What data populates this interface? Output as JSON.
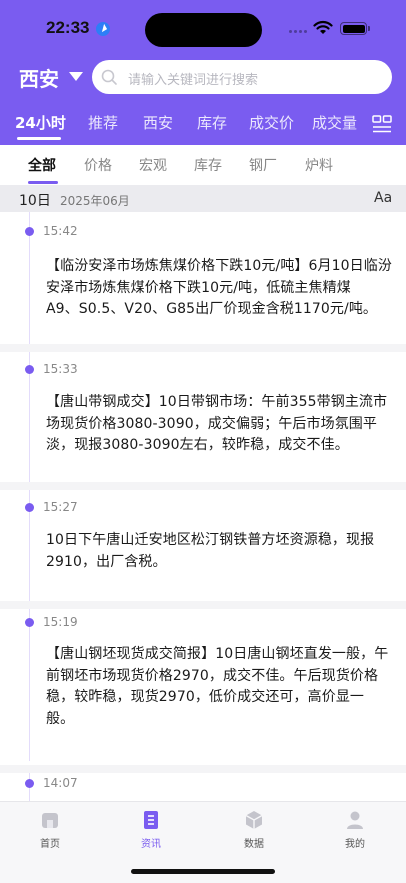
{
  "status_bar": {
    "time": "22:33"
  },
  "header": {
    "city": "西安",
    "search_placeholder": "请输入关键词进行搜索",
    "tabs": [
      "24小时",
      "推荐",
      "西安",
      "库存",
      "成交价",
      "成交量"
    ],
    "accent_color": "#7a5cf0"
  },
  "subtabs": [
    "全部",
    "价格",
    "宏观",
    "库存",
    "钢厂",
    "炉料"
  ],
  "date_bar": {
    "day": "10日",
    "year_month": "2025年06月",
    "font_toggle": "Aa"
  },
  "feed": [
    {
      "time": "15:42",
      "lines": [
        "【临汾安泽市场炼焦煤价格下跌10元/吨】6月10日临汾",
        "安泽市场炼焦煤价格下跌10元/吨，低硫主焦精煤",
        "A9、S0.5、V20、G85出厂价现金含税1170元/吨。"
      ]
    },
    {
      "time": "15:33",
      "lines": [
        "【唐山带钢成交】10日带钢市场：午前355带钢主流市",
        "场现货价格3080-3090，成交偏弱；午后市场氛围平",
        "淡，现报3080-3090左右，较昨稳，成交不佳。"
      ]
    },
    {
      "time": "15:27",
      "lines": [
        "10日下午唐山迁安地区松汀钢铁普方坯资源稳，现报",
        "2910，出厂含税。"
      ]
    },
    {
      "time": "15:19",
      "lines": [
        "【唐山钢坯现货成交简报】10日唐山钢坯直发一般，午",
        "前钢坯市场现货价格2970，成交不佳。午后现货价格",
        "稳，较昨稳，现货2970，低价成交还可，高价显一",
        "般。"
      ]
    },
    {
      "time": "14:07",
      "lines": []
    }
  ],
  "bottom_nav": [
    {
      "label": "首页",
      "icon": "home-icon"
    },
    {
      "label": "资讯",
      "icon": "news-icon"
    },
    {
      "label": "数据",
      "icon": "data-cube-icon"
    },
    {
      "label": "我的",
      "icon": "profile-icon"
    }
  ]
}
